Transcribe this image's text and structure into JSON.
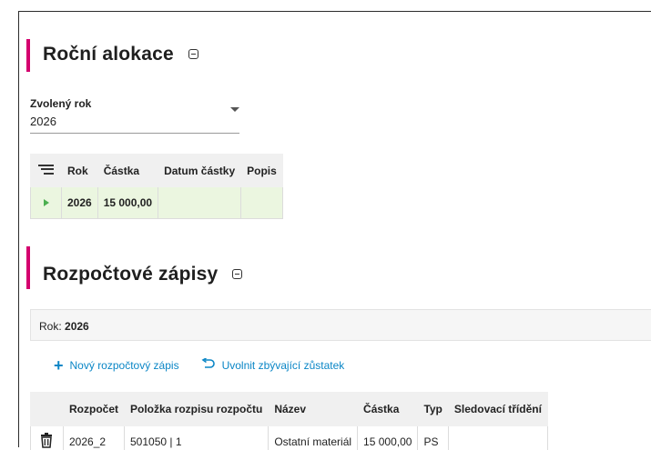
{
  "annual_allocation": {
    "title": "Roční alokace",
    "year_label": "Zvolený rok",
    "year_value": "2026",
    "columns": [
      "Rok",
      "Částka",
      "Datum částky",
      "Popis"
    ],
    "rows": [
      {
        "rok": "2026",
        "castka": "15 000,00",
        "datum": "",
        "popis": ""
      }
    ]
  },
  "budget_entries": {
    "title": "Rozpočtové zápisy",
    "year_prefix": "Rok:",
    "year_value": "2026",
    "new_entry_label": "Nový rozpočtový zápis",
    "release_label": "Uvolnit zbývající zůstatek",
    "columns": [
      "Rozpočet",
      "Položka rozpisu rozpočtu",
      "Název",
      "Částka",
      "Typ",
      "Sledovací třídění"
    ],
    "rows": [
      {
        "rozpocet": "2026_2",
        "polozka": "501050 | 1",
        "nazev": "Ostatní materiál",
        "castka": "15 000,00",
        "typ": "PS",
        "sledovaci": ""
      }
    ]
  },
  "colors": {
    "accent": "#d4006e",
    "link": "#0a86c6",
    "row_highlight": "#ebf6e0"
  }
}
